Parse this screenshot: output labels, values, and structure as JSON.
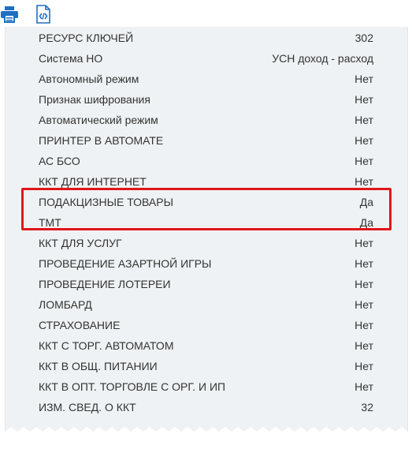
{
  "toolbar": {
    "print_icon": "printer-icon",
    "xml_icon": "xml-file-icon",
    "accent_color": "#1e6fc4"
  },
  "receipt": {
    "rows": [
      {
        "label": "РЕСУРС КЛЮЧЕЙ",
        "value": "302"
      },
      {
        "label": "Система НО",
        "value": "УСН доход - расход"
      },
      {
        "label": "Автономный режим",
        "value": "Нет"
      },
      {
        "label": "Признак шифрования",
        "value": "Нет"
      },
      {
        "label": "Автоматический режим",
        "value": "Нет"
      },
      {
        "label": "ПРИНТЕР В АВТОМАТЕ",
        "value": "Нет"
      },
      {
        "label": "АС БСО",
        "value": "Нет"
      },
      {
        "label": "ККТ ДЛЯ ИНТЕРНЕТ",
        "value": "Нет"
      },
      {
        "label": "ПОДАКЦИЗНЫЕ ТОВАРЫ",
        "value": "Да"
      },
      {
        "label": "ТМТ",
        "value": "Да"
      },
      {
        "label": "ККТ ДЛЯ УСЛУГ",
        "value": "Нет"
      },
      {
        "label": "ПРОВЕДЕНИЕ АЗАРТНОЙ ИГРЫ",
        "value": "Нет"
      },
      {
        "label": "ПРОВЕДЕНИЕ ЛОТЕРЕИ",
        "value": "Нет"
      },
      {
        "label": "ЛОМБАРД",
        "value": "Нет"
      },
      {
        "label": "СТРАХОВАНИЕ",
        "value": "Нет"
      },
      {
        "label": "ККТ С ТОРГ. АВТОМАТОМ",
        "value": "Нет"
      },
      {
        "label": "ККТ В ОБЩ. ПИТАНИИ",
        "value": "Нет"
      },
      {
        "label": "ККТ В ОПТ. ТОРГОВЛЕ С ОРГ. И ИП",
        "value": "Нет"
      },
      {
        "label": "ИЗМ. СВЕД. О ККТ",
        "value": "32"
      }
    ],
    "highlight_color": "#e0161b"
  }
}
